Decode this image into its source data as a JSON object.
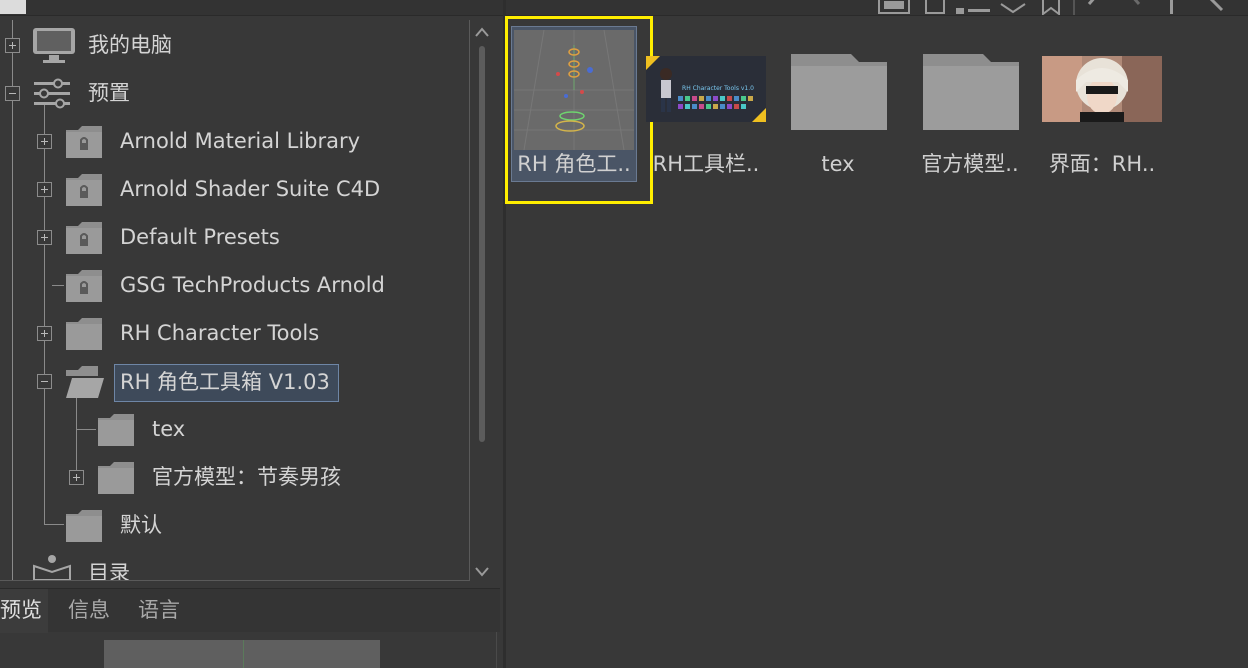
{
  "tree": {
    "items": [
      {
        "label": "我的电脑",
        "icon": "computer-icon"
      },
      {
        "label": "预置",
        "icon": "sliders-icon"
      },
      {
        "label": "Arnold Material Library",
        "icon": "locked-folder-icon"
      },
      {
        "label": "Arnold Shader Suite C4D",
        "icon": "locked-folder-icon"
      },
      {
        "label": "Default Presets",
        "icon": "locked-folder-icon"
      },
      {
        "label": "GSG TechProducts Arnold",
        "icon": "locked-folder-icon"
      },
      {
        "label": "RH Character Tools",
        "icon": "folder-icon"
      },
      {
        "label": "RH 角色工具箱 V1.03",
        "icon": "open-folder-icon",
        "selected": true
      },
      {
        "label": "tex",
        "icon": "folder-icon"
      },
      {
        "label": "官方模型：节奏男孩",
        "icon": "folder-icon"
      },
      {
        "label": "默认",
        "icon": "folder-icon"
      },
      {
        "label": "目录",
        "icon": "catalog-icon"
      }
    ]
  },
  "tabs": [
    {
      "label": "预览",
      "active": true
    },
    {
      "label": "信息",
      "active": false
    },
    {
      "label": "语言",
      "active": false
    }
  ],
  "content": {
    "tiles": [
      {
        "label": "RH 角色工..",
        "thumb": "scene-thumbnail",
        "selected": true,
        "highlighted": true
      },
      {
        "label": "RH工具栏..",
        "thumb": "banner-thumbnail",
        "banner_title": "RH Character Tools v1.0"
      },
      {
        "label": "tex",
        "thumb": "folder-icon"
      },
      {
        "label": "官方模型..",
        "thumb": "folder-icon"
      },
      {
        "label": "界面：RH..",
        "thumb": "portrait-thumbnail"
      }
    ]
  },
  "colors": {
    "background": "#383838",
    "highlight": "#ffee00",
    "selection": "#3e4a5a"
  }
}
